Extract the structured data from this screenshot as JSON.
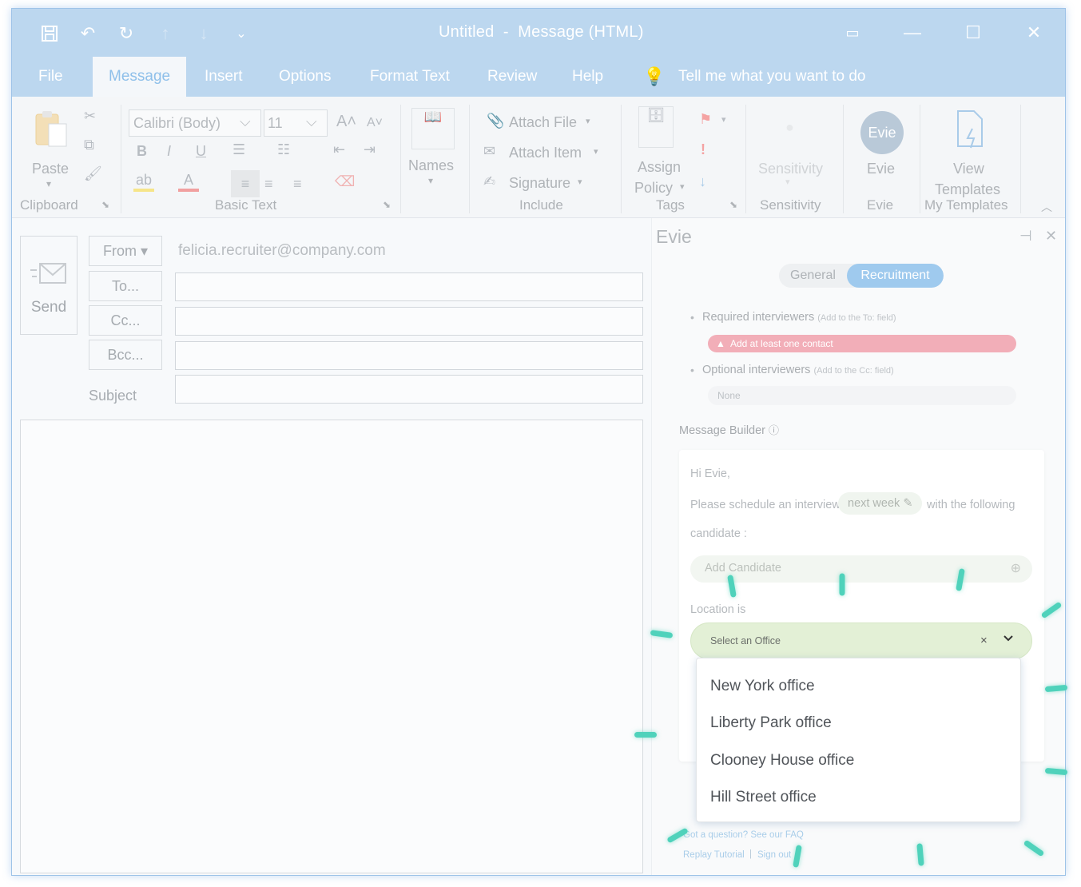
{
  "window": {
    "title": "Untitled  -  Message (HTML)",
    "quick_access": [
      {
        "name": "save-icon",
        "glyph": "💾"
      },
      {
        "name": "undo-icon",
        "glyph": "↶"
      },
      {
        "name": "redo-icon",
        "glyph": "↻"
      },
      {
        "name": "previous-item-icon",
        "glyph": "↑"
      },
      {
        "name": "next-item-icon",
        "glyph": "↓"
      },
      {
        "name": "customize-toolbar-icon",
        "glyph": "⌄"
      }
    ]
  },
  "menu": {
    "tabs": [
      "File",
      "Message",
      "Insert",
      "Options",
      "Format Text",
      "Review",
      "Help"
    ],
    "active": "Message",
    "tell_me": "Tell me what you want to do"
  },
  "ribbon": {
    "clipboard": {
      "paste": "Paste",
      "label": "Clipboard"
    },
    "basic_text": {
      "font": "Calibri (Body)",
      "size": "11",
      "label": "Basic Text"
    },
    "names": {
      "label": "Names"
    },
    "include": {
      "attach_file": "Attach File",
      "attach_item": "Attach Item",
      "signature": "Signature",
      "label": "Include"
    },
    "tags": {
      "assign": "Assign",
      "policy": "Policy",
      "label": "Tags"
    },
    "sensitivity": {
      "button": "Sensitivity",
      "label": "Sensitivity"
    },
    "evie": {
      "avatar": "Evie",
      "button": "Evie",
      "label": "Evie"
    },
    "templates": {
      "view": "View",
      "templates": "Templates",
      "label": "My Templates"
    }
  },
  "compose": {
    "send": "Send",
    "from_button": "From",
    "from_value": "felicia.recruiter@company.com",
    "to_button": "To...",
    "cc_button": "Cc...",
    "bcc_button": "Bcc...",
    "subject_label": "Subject"
  },
  "evie_pane": {
    "title": "Evie",
    "tabs": [
      "General",
      "Recruitment"
    ],
    "active_tab": "Recruitment",
    "required_label": "Required interviewers",
    "required_hint": "(Add to the To: field)",
    "required_warning": "Add at least one contact",
    "optional_label": "Optional interviewers",
    "optional_hint": "(Add to the Cc: field)",
    "optional_value": "None",
    "message_builder_label": "Message Builder",
    "greeting": "Hi Evie,",
    "schedule_prefix": "Please schedule an interview",
    "time_chip": "next week",
    "schedule_suffix": "with the following",
    "schedule_suffix_2": "candidate :",
    "add_candidate": "Add Candidate",
    "location_label": "Location is",
    "office_select": {
      "placeholder": "Select an Office",
      "clear": "×"
    },
    "office_options": [
      "New York office",
      "Liberty Park office",
      "Clooney House office",
      "Hill Street office"
    ],
    "faq_link": "Got a question? See our FAQ",
    "replay_tutorial": "Replay Tutorial",
    "link_separator": "|",
    "sign_out": "Sign out"
  }
}
